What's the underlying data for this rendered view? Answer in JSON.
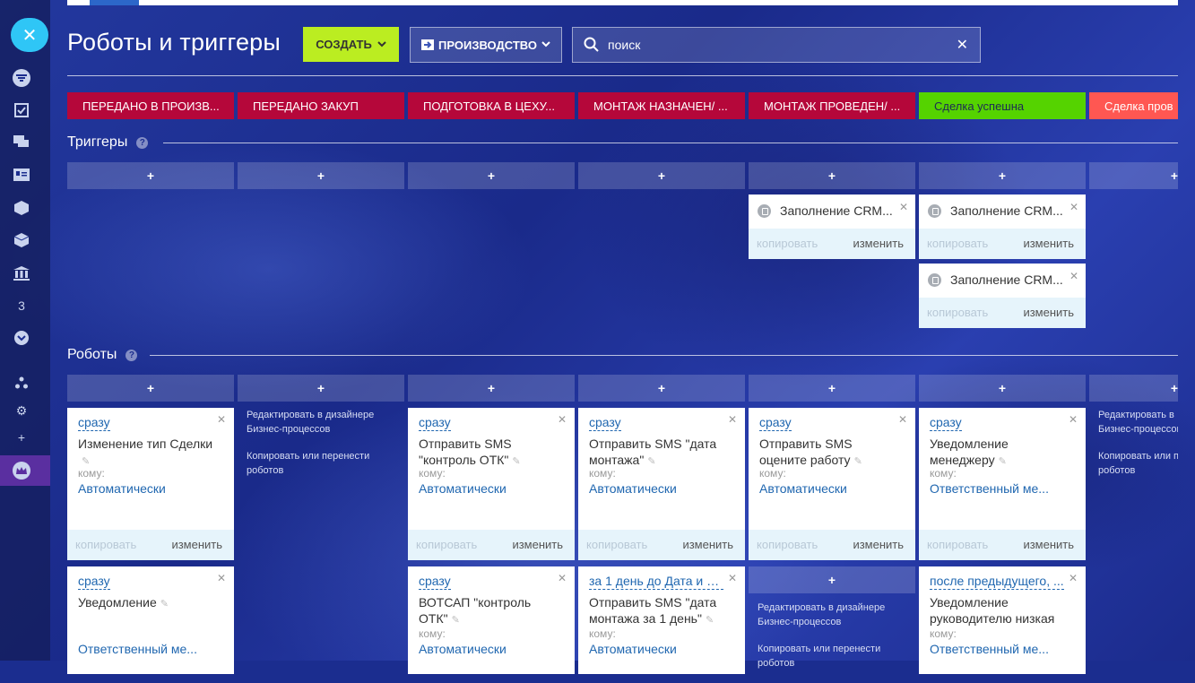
{
  "page": {
    "title": "Роботы и триггеры"
  },
  "header": {
    "create_label": "СОЗДАТЬ",
    "pipeline_label": "ПРОИЗВОДСТВО",
    "search_placeholder": "поиск"
  },
  "stages": [
    {
      "label": "ПЕРЕДАНО В ПРОИЗВ...",
      "color": "#b5073a"
    },
    {
      "label": "ПЕРЕДАНО ЗАКУП",
      "color": "#b5073a"
    },
    {
      "label": "ПОДГОТОВКА В ЦЕХУ...",
      "color": "#b5073a"
    },
    {
      "label": "МОНТАЖ НАЗНАЧЕН/ ...",
      "color": "#b5073a"
    },
    {
      "label": "МОНТАЖ ПРОВЕДЕН/ ...",
      "color": "#b5073a"
    },
    {
      "label": "Сделка успешна",
      "color": "#55d300"
    },
    {
      "label": "Сделка пров",
      "color": "#ff5752"
    }
  ],
  "sidebar": {
    "counter": "3"
  },
  "triggers": {
    "section_title": "Триггеры",
    "add": "+",
    "cards": [
      {
        "name": "Заполнение CRM...",
        "copy": "копировать",
        "edit": "изменить"
      },
      {
        "name": "Заполнение CRM...",
        "copy": "копировать",
        "edit": "изменить"
      },
      {
        "name": "Заполнение CRM...",
        "copy": "копировать",
        "edit": "изменить"
      }
    ]
  },
  "robots": {
    "section_title": "Роботы",
    "add": "+",
    "edit_in_designer": "Редактировать в дизайнере Бизнес-процессов",
    "copy_or_move": "Копировать или перенести роботов",
    "edit_in_designer_cut": "Редактировать в",
    "edit_in_designer_cut2": "Бизнес-процессов",
    "copy_or_move_cut": "Копировать или п",
    "copy_or_move_cut2": "роботов",
    "to_label": "кому:",
    "copy": "копировать",
    "edit": "изменить",
    "cards": [
      {
        "when": "сразу",
        "name": "Изменение тип Сделки",
        "to": "Автоматически"
      },
      {
        "when": "сразу",
        "name": "Отправить SMS \"контроль ОТК\"",
        "to": "Автоматически"
      },
      {
        "when": "сразу",
        "name": "Отправить SMS \"дата монтажа\"",
        "to": "Автоматически"
      },
      {
        "when": "сразу",
        "name": "Отправить SMS оцените работу",
        "to": "Автоматически"
      },
      {
        "when": "сразу",
        "name": "Уведомление менеджеру",
        "to": "Ответственный ме..."
      },
      {
        "when": "сразу",
        "name": "Уведомление",
        "to": "Ответственный ме..."
      },
      {
        "when": "сразу",
        "name": "ВОТСАП \"контроль ОТК\"",
        "to": "Автоматически"
      },
      {
        "when": "за 1 день до Дата и в...",
        "name": "Отправить SMS \"дата монтажа за 1 день\"",
        "to": "Автоматически"
      },
      {
        "when": "после предыдущего, ...",
        "name": "Уведомление руководителю низкая",
        "to": "Ответственный ме..."
      }
    ]
  }
}
